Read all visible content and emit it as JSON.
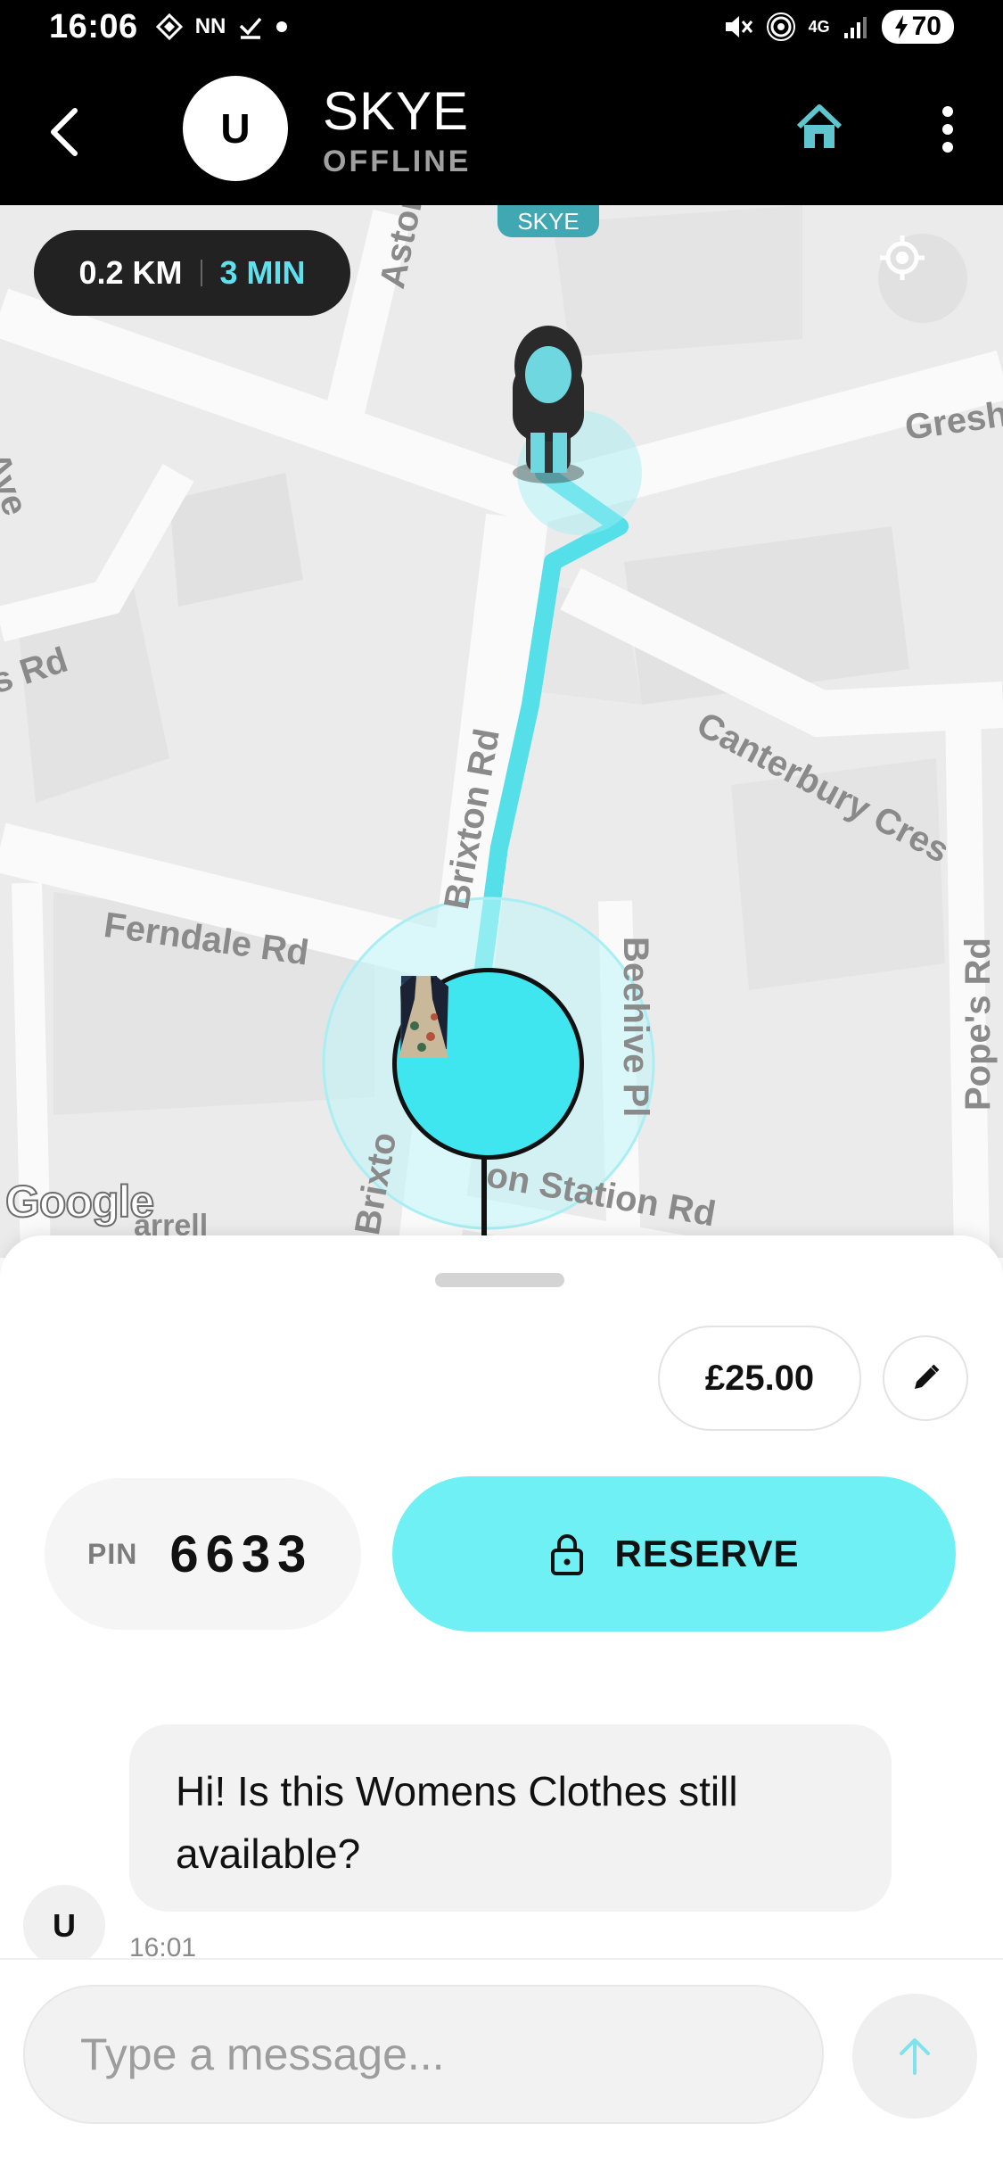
{
  "status_bar": {
    "time": "16:06",
    "carrier": "NN",
    "battery": "70",
    "network": "4G"
  },
  "header": {
    "avatar_letter": "U",
    "name": "SKYE",
    "status": "OFFLINE",
    "icons": [
      "back-arrow-icon",
      "home-icon",
      "more-vertical-icon"
    ]
  },
  "map": {
    "distance": "0.2 KM",
    "duration": "3 MIN",
    "courier_tag": "SKYE",
    "attribution": "Google",
    "streets": {
      "astoria": "Astori",
      "gresham": "Gresh",
      "rd_left": "s Rd",
      "ave_left": "Ave",
      "canterbury": "Canterbury Cres",
      "brixton": "Brixton Rd",
      "ferndale": "Ferndale Rd",
      "beehive": "Beehive Pl",
      "popes": "Pope's Rd",
      "station": "on Station Rd",
      "brixton_lower": "Brixto",
      "farrell": "arrell"
    },
    "route_color": "#55dfe9",
    "items": [
      "jeans",
      "blazer",
      "floral-dress"
    ]
  },
  "sheet": {
    "price": "£25.00",
    "pin_label": "PIN",
    "pin_value": "6633",
    "reserve_label": "RESERVE",
    "accent_color": "#6ff0f4"
  },
  "chat": {
    "messages": [
      {
        "sender_initial": "U",
        "text": "Hi! Is this Womens Clothes still available?",
        "time": "16:01"
      }
    ]
  },
  "composer": {
    "placeholder": "Type a message..."
  }
}
